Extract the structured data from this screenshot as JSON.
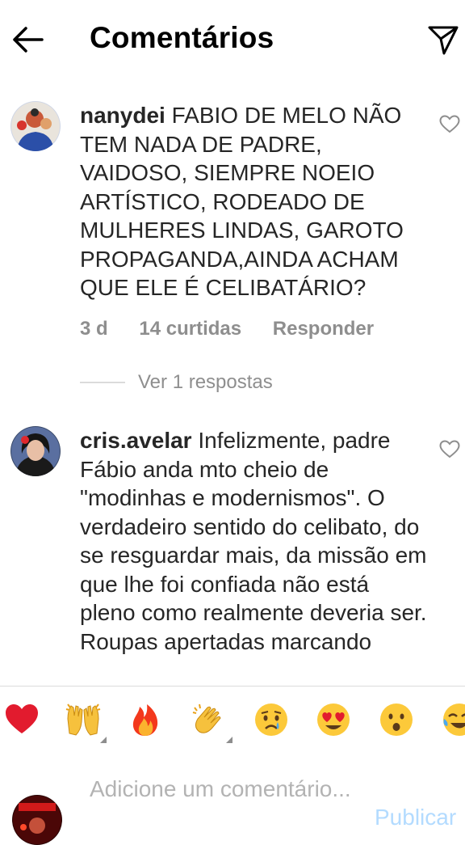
{
  "header": {
    "title": "Comentários"
  },
  "comments": [
    {
      "username": "nanydei",
      "text": "FABIO DE MELO NÃO TEM NADA DE PADRE, VAIDOSO, SIEMPRE NOEIO ARTÍSTICO, RODEADO DE MULHERES LINDAS, GAROTO PROPAGANDA,AINDA ACHAM QUE ELE É CELIBATÁRIO?",
      "time": "3 d",
      "likes": "14 curtidas",
      "reply_label": "Responder",
      "view_replies": "Ver 1 respostas"
    },
    {
      "username": "cris.avelar",
      "text": "Infelizmente, padre Fábio anda mto cheio de \"modinhas e modernismos\". O verdadeiro sentido do celibato, do se resguardar mais, da missão em que lhe foi confiada não está pleno como realmente deveria ser. Roupas apertadas marcando"
    }
  ],
  "emoji_bar": [
    {
      "name": "red-heart",
      "glyph": "❤"
    },
    {
      "name": "raising-hands",
      "glyph": "🙌"
    },
    {
      "name": "fire",
      "glyph": "🔥"
    },
    {
      "name": "clapping-hands",
      "glyph": "👏"
    },
    {
      "name": "crying-face",
      "glyph": "😢"
    },
    {
      "name": "heart-eyes",
      "glyph": "😍"
    },
    {
      "name": "astonished-face",
      "glyph": "😮"
    },
    {
      "name": "tears-of-joy",
      "glyph": "😂"
    }
  ],
  "composer": {
    "placeholder": "Adicione um comentário...",
    "post_label": "Publicar"
  },
  "colors": {
    "text": "#262626",
    "secondary": "#8e8e8e",
    "divider": "#dbdbdb",
    "post_disabled": "#b3dbff"
  }
}
